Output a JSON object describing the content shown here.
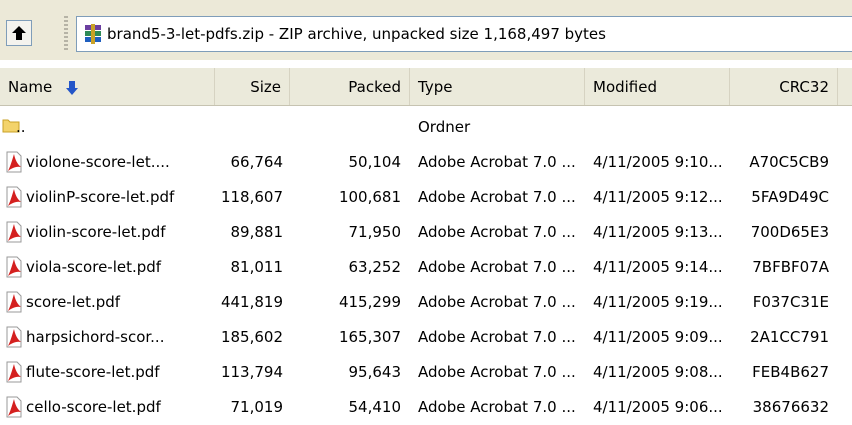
{
  "toolbar": {
    "up_icon": "up-folder-icon",
    "archive_icon": "rar-archive-icon",
    "path": "brand5-3-let-pdfs.zip - ZIP archive, unpacked size 1,168,497 bytes"
  },
  "columns": {
    "name": "Name",
    "size": "Size",
    "packed": "Packed",
    "type": "Type",
    "modified": "Modified",
    "crc": "CRC32",
    "sort_icon": "sort-down-arrow-icon"
  },
  "parent_row": {
    "name": "..",
    "type": "Ordner",
    "icon": "folder-icon"
  },
  "files": [
    {
      "name": "violone-score-let....",
      "size": "66,764",
      "packed": "50,104",
      "type": "Adobe Acrobat 7.0 ...",
      "modified": "4/11/2005 9:10...",
      "crc": "A70C5CB9"
    },
    {
      "name": "violinP-score-let.pdf",
      "size": "118,607",
      "packed": "100,681",
      "type": "Adobe Acrobat 7.0 ...",
      "modified": "4/11/2005 9:12...",
      "crc": "5FA9D49C"
    },
    {
      "name": "violin-score-let.pdf",
      "size": "89,881",
      "packed": "71,950",
      "type": "Adobe Acrobat 7.0 ...",
      "modified": "4/11/2005 9:13...",
      "crc": "700D65E3"
    },
    {
      "name": "viola-score-let.pdf",
      "size": "81,011",
      "packed": "63,252",
      "type": "Adobe Acrobat 7.0 ...",
      "modified": "4/11/2005 9:14...",
      "crc": "7BFBF07A"
    },
    {
      "name": "score-let.pdf",
      "size": "441,819",
      "packed": "415,299",
      "type": "Adobe Acrobat 7.0 ...",
      "modified": "4/11/2005 9:19...",
      "crc": "F037C31E"
    },
    {
      "name": "harpsichord-scor...",
      "size": "185,602",
      "packed": "165,307",
      "type": "Adobe Acrobat 7.0 ...",
      "modified": "4/11/2005 9:09...",
      "crc": "2A1CC791"
    },
    {
      "name": "flute-score-let.pdf",
      "size": "113,794",
      "packed": "95,643",
      "type": "Adobe Acrobat 7.0 ...",
      "modified": "4/11/2005 9:08...",
      "crc": "FEB4B627"
    },
    {
      "name": "cello-score-let.pdf",
      "size": "71,019",
      "packed": "54,410",
      "type": "Adobe Acrobat 7.0 ...",
      "modified": "4/11/2005 9:06...",
      "crc": "38676632"
    }
  ],
  "file_icon": "pdf-file-icon",
  "colors": {
    "header_bg": "#ebeadb",
    "toolbar_bg": "#ece9d8",
    "pdf_red": "#d4201f"
  }
}
